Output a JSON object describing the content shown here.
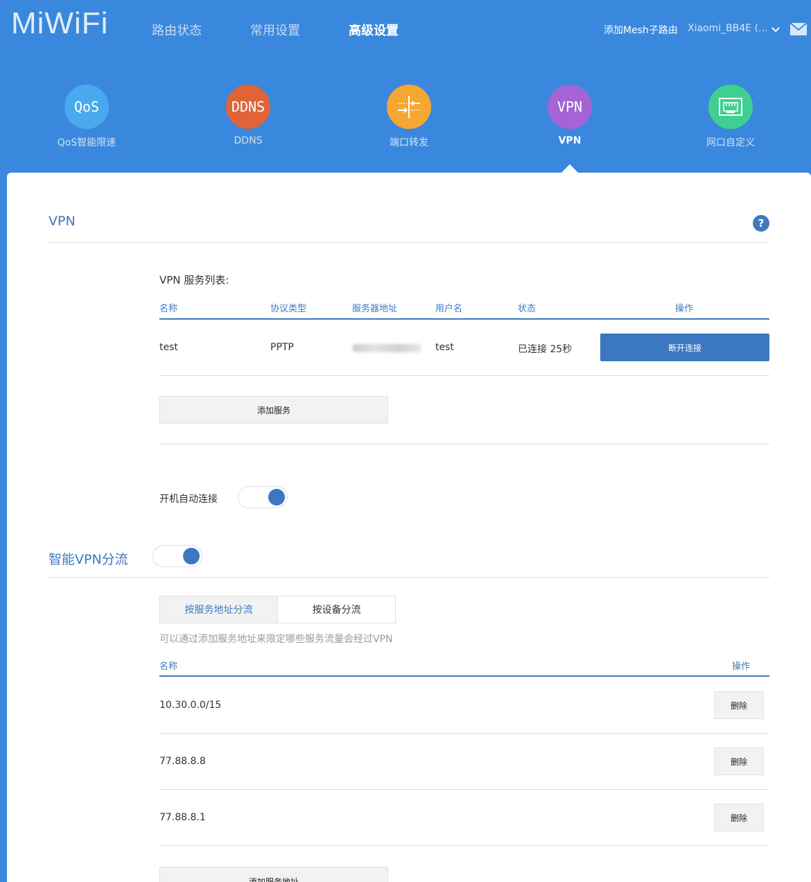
{
  "header": {
    "logo": "MiWiFi",
    "nav": [
      "路由状态",
      "常用设置",
      "高级设置"
    ],
    "mesh_link": "添加Mesh子路由",
    "device_name": "Xiaomi_BB4E (..."
  },
  "features": [
    {
      "icon_text": "QoS",
      "label": "QoS智能限速",
      "color": "#4aa9ee",
      "icon": "qos-icon"
    },
    {
      "icon_text": "DDNS",
      "label": "DDNS",
      "color": "#e0643a",
      "icon": "ddns-icon"
    },
    {
      "icon_text": "",
      "label": "端口转发",
      "color": "#f5a633",
      "icon": "port-forward-icon"
    },
    {
      "icon_text": "VPN",
      "label": "VPN",
      "color": "#a563d6",
      "icon": "vpn-icon"
    },
    {
      "icon_text": "",
      "label": "网口自定义",
      "color": "#3fcf90",
      "icon": "ethernet-port-icon"
    }
  ],
  "vpn": {
    "title": "VPN",
    "help": "?",
    "list_title": "VPN 服务列表:",
    "columns": [
      "名称",
      "协议类型",
      "服务器地址",
      "用户名",
      "状态",
      "操作"
    ],
    "rows": [
      {
        "name": "test",
        "protocol": "PPTP",
        "server": "",
        "user": "test",
        "status": "已连接 25秒",
        "action": "断开连接"
      }
    ],
    "add_button": "添加服务",
    "auto_connect_label": "开机自动连接",
    "auto_connect_on": true
  },
  "smart": {
    "title": "智能VPN分流",
    "enabled": true,
    "tabs": [
      "按服务地址分流",
      "按设备分流"
    ],
    "hint": "可以通过添加服务地址来限定哪些服务流量会经过VPN",
    "columns": [
      "名称",
      "操作"
    ],
    "rows": [
      {
        "name": "10.30.0.0/15",
        "action": "删除"
      },
      {
        "name": "77.88.8.8",
        "action": "删除"
      },
      {
        "name": "77.88.8.1",
        "action": "删除"
      }
    ],
    "add_button": "添加服务地址"
  }
}
